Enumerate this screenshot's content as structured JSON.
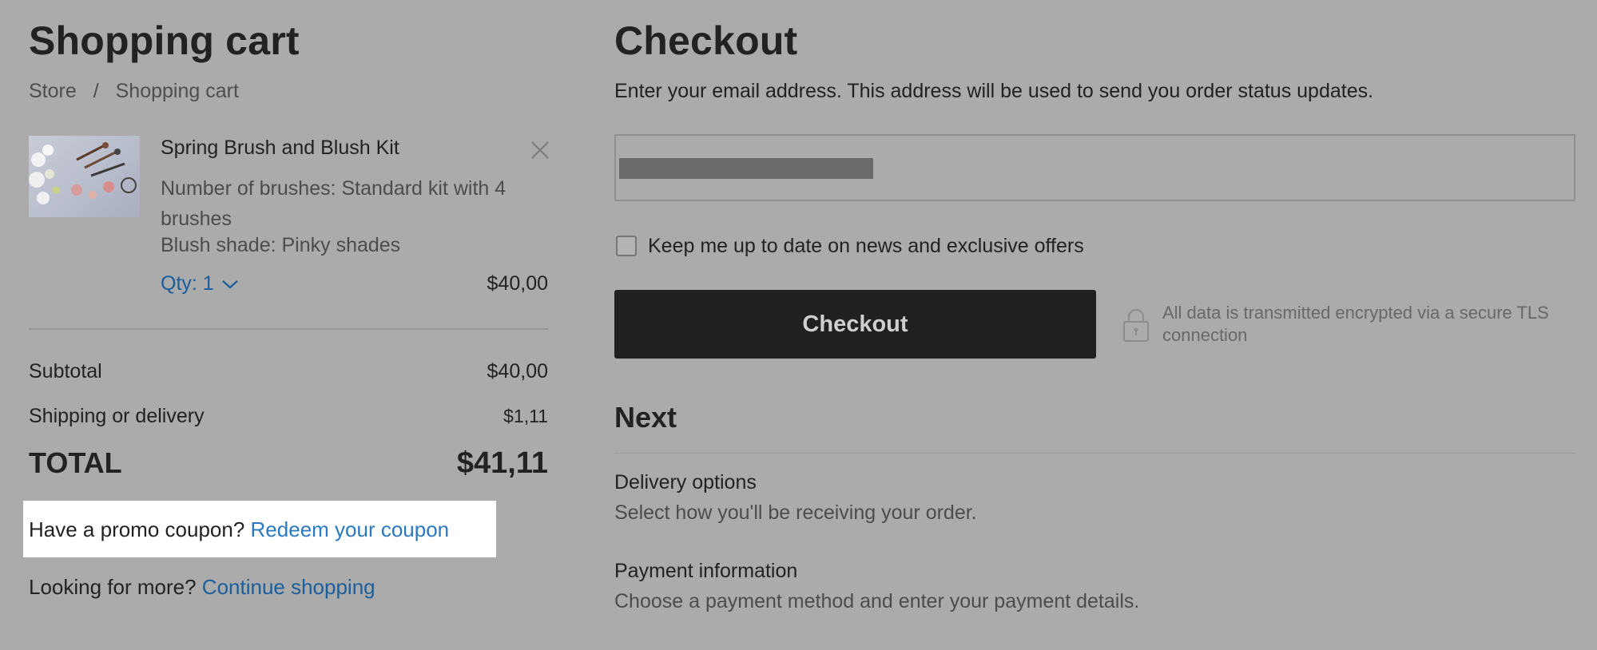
{
  "cart": {
    "title": "Shopping cart",
    "breadcrumb": {
      "store": "Store",
      "separator": "/",
      "current": "Shopping cart"
    },
    "item": {
      "name": "Spring Brush and Blush Kit",
      "option1": "Number of brushes: Standard kit with 4 brushes",
      "option2": "Blush shade: Pinky shades",
      "qty_label": "Qty: 1",
      "price": "$40,00",
      "remove_icon": "close-icon",
      "qty_icon": "chevron-down-icon"
    },
    "subtotal_label": "Subtotal",
    "subtotal_value": "$40,00",
    "shipping_label": "Shipping or delivery",
    "shipping_value": "$1,11",
    "total_label": "TOTAL",
    "total_value": "$41,11",
    "promo_text": "Have a promo coupon?",
    "promo_link": "Redeem your coupon",
    "more_text": "Looking for more?",
    "more_link": "Continue shopping"
  },
  "checkout": {
    "title": "Checkout",
    "description": "Enter your email address. This address will be used to send you order status updates.",
    "email_value": "",
    "newsletter_label": "Keep me up to date on news and exclusive offers",
    "newsletter_checked": false,
    "button_label": "Checkout",
    "security_icon": "lock-icon",
    "security_note": "All data is transmitted encrypted via a secure TLS connection",
    "next_title": "Next",
    "steps": [
      {
        "title": "Delivery options",
        "desc": "Select how you'll be receiving your order."
      },
      {
        "title": "Payment information",
        "desc": "Choose a payment method and enter your payment details."
      }
    ]
  },
  "colors": {
    "overlay_bg": "#ababab",
    "link": "#1c5e9b",
    "button_bg": "#202020",
    "highlight": "#ffffff"
  }
}
